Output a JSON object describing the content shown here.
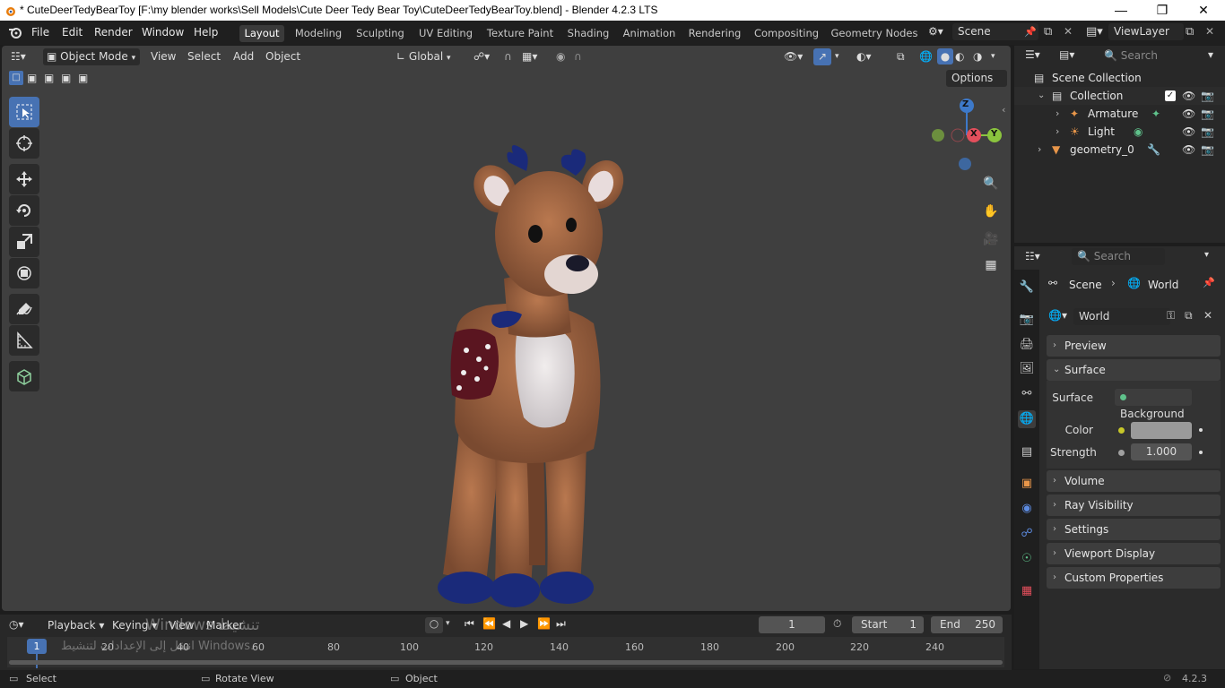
{
  "window": {
    "title": "* CuteDeerTedyBearToy [F:\\my blender works\\Sell Models\\Cute Deer Tedy Bear Toy\\CuteDeerTedyBearToy.blend] - Blender 4.2.3 LTS",
    "minimize": "—",
    "maximize": "❐",
    "close": "✕"
  },
  "menubar": {
    "file": "File",
    "edit": "Edit",
    "render": "Render",
    "window": "Window",
    "help": "Help"
  },
  "workspaces": [
    "Layout",
    "Modeling",
    "Sculpting",
    "UV Editing",
    "Texture Paint",
    "Shading",
    "Animation",
    "Rendering",
    "Compositing",
    "Geometry Nodes"
  ],
  "scene_selector": "Scene",
  "viewlayer_selector": "ViewLayer",
  "viewport_header": {
    "mode": "Object Mode",
    "view": "View",
    "select": "Select",
    "add": "Add",
    "object": "Object",
    "orientation": "Global",
    "options": "Options"
  },
  "gizmo": {
    "z": "Z",
    "x": "X",
    "y": "Y"
  },
  "outliner": {
    "search_placeholder": "Search",
    "scene_collection": "Scene Collection",
    "collection": "Collection",
    "armature": "Armature",
    "light": "Light",
    "geometry": "geometry_0"
  },
  "properties": {
    "search_placeholder": "Search",
    "breadcrumb_scene": "Scene",
    "breadcrumb_world": "World",
    "world_name": "World",
    "panels": {
      "preview": "Preview",
      "surface": "Surface",
      "volume": "Volume",
      "ray_visibility": "Ray Visibility",
      "settings": "Settings",
      "viewport_display": "Viewport Display",
      "custom_properties": "Custom Properties"
    },
    "surface_label": "Surface",
    "surface_value": "Background",
    "color_label": "Color",
    "color_value": "#9a9a9a",
    "strength_label": "Strength",
    "strength_value": "1.000"
  },
  "timeline": {
    "playback": "Playback",
    "keying": "Keying",
    "view": "View",
    "marker": "Marker",
    "current_frame": "1",
    "start_label": "Start",
    "start_value": "1",
    "end_label": "End",
    "end_value": "250",
    "playhead": "1",
    "ticks": [
      "20",
      "40",
      "60",
      "80",
      "100",
      "120",
      "140",
      "160",
      "180",
      "200",
      "220",
      "240"
    ]
  },
  "watermark": {
    "line1": "Windows تنشيط",
    "line2": "انتقل إلى الإعدادات لتنشيط Windows."
  },
  "statusbar": {
    "select": "Select",
    "rotate_view": "Rotate View",
    "object": "Object",
    "version": "4.2.3"
  },
  "colors": {
    "accent": "#4772b3",
    "x_axis": "#e34f5c",
    "y_axis": "#8bc43e",
    "z_axis": "#3d79c9"
  }
}
